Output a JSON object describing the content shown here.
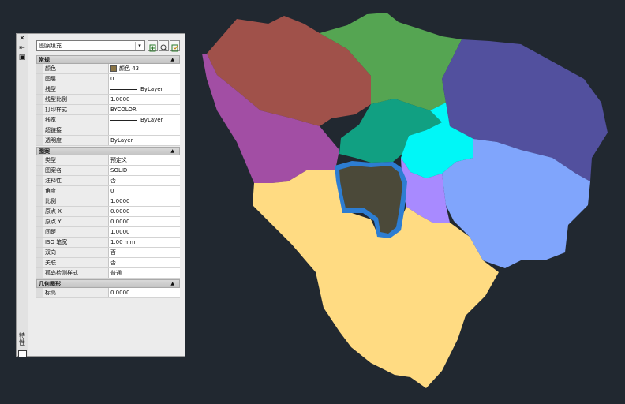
{
  "palette": {
    "selector_value": "图案填充",
    "strip_title": "特性",
    "sections": [
      {
        "title": "常规",
        "rows": [
          {
            "label": "颜色",
            "value": "颜色 43",
            "swatch": "#8a7444"
          },
          {
            "label": "图层",
            "value": "0"
          },
          {
            "label": "线型",
            "value": "ByLayer",
            "line": true
          },
          {
            "label": "线型比例",
            "value": "1.0000"
          },
          {
            "label": "打印样式",
            "value": "BYCOLOR"
          },
          {
            "label": "线宽",
            "value": "ByLayer",
            "line": true
          },
          {
            "label": "超链接",
            "value": ""
          },
          {
            "label": "透明度",
            "value": "ByLayer"
          }
        ]
      },
      {
        "title": "图案",
        "rows": [
          {
            "label": "类型",
            "value": "预定义"
          },
          {
            "label": "图案名",
            "value": "SOLID"
          },
          {
            "label": "注释性",
            "value": "否"
          },
          {
            "label": "角度",
            "value": "0"
          },
          {
            "label": "比例",
            "value": "1.0000"
          },
          {
            "label": "原点 X",
            "value": "0.0000"
          },
          {
            "label": "原点 Y",
            "value": "0.0000"
          },
          {
            "label": "间距",
            "value": "1.0000"
          },
          {
            "label": "ISO 笔宽",
            "value": "1.00 mm"
          },
          {
            "label": "双向",
            "value": "否"
          },
          {
            "label": "关联",
            "value": "否"
          },
          {
            "label": "孤岛检测样式",
            "value": "普通"
          }
        ]
      },
      {
        "title": "几何图形",
        "rows": [
          {
            "label": "标高",
            "value": "0.0000"
          }
        ]
      }
    ]
  },
  "map": {
    "background": "#212830",
    "region_colors": {
      "northwest": "#a0514a",
      "north": "#55a552",
      "northeast": "#52509e",
      "west": "#a24ea4",
      "center_teal": "#11a082",
      "center_cyan": "#00f7f7",
      "east": "#80a5fc",
      "south": "#ffdb82",
      "lilac": "#a88aff",
      "selected_fill": "#4b4939",
      "selected_outline": "#2d7dd2"
    }
  }
}
